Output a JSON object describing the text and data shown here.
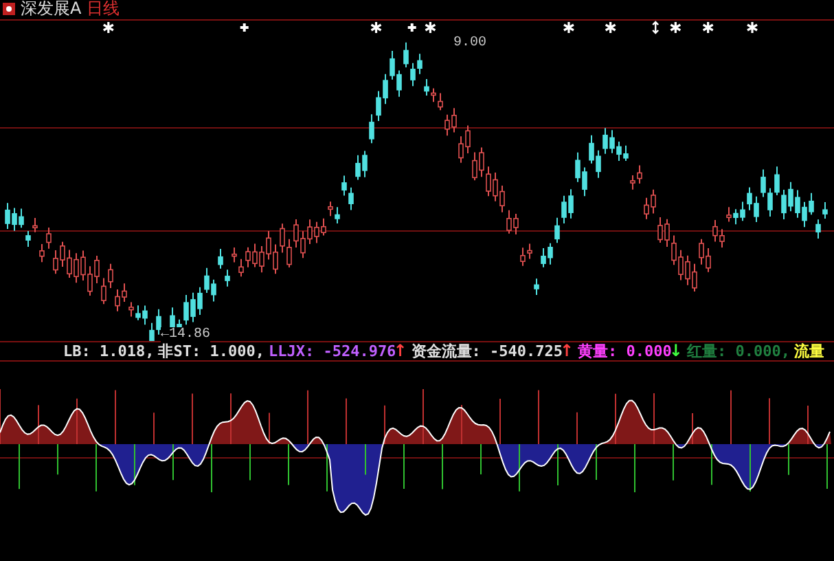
{
  "header": {
    "title": "深发展A",
    "period": "日线"
  },
  "price_chart": {
    "high_label": "9.00",
    "low_label": "←14.86",
    "signals": [
      {
        "kind": "star"
      },
      {
        "kind": "plus"
      },
      {
        "kind": "star"
      },
      {
        "kind": "plus"
      },
      {
        "kind": "star"
      },
      {
        "kind": "star"
      },
      {
        "kind": "star"
      },
      {
        "kind": "updown"
      },
      {
        "kind": "star"
      },
      {
        "kind": "star"
      },
      {
        "kind": "star"
      }
    ]
  },
  "indicator": {
    "values": [
      {
        "text": "LB: 1.018,",
        "color": "#e0e0e0"
      },
      {
        "text": "非ST: 1.000,",
        "color": "#e0e0e0"
      },
      {
        "text": "LLJX: -524.976",
        "color": "#c060ff",
        "arrow": {
          "text": "↑",
          "color": "#ff4040"
        }
      },
      {
        "text": "资金流量: -540.725",
        "color": "#e0e0e0",
        "arrow": {
          "text": "↑",
          "color": "#ff4040"
        }
      },
      {
        "text": "黄量: 0.000",
        "color": "#ff40ff",
        "arrow": {
          "text": "↓",
          "color": "#40ff40"
        }
      },
      {
        "text": "红量: 0.000,",
        "color": "#208040"
      },
      {
        "text": "流量",
        "color": "#ffff40"
      }
    ]
  }
}
